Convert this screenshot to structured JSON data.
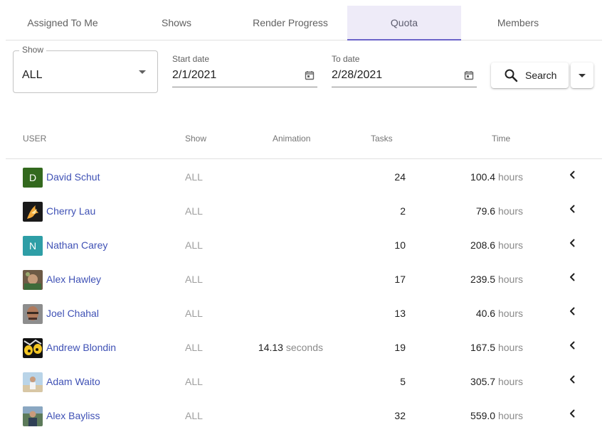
{
  "tabs": [
    {
      "label": "Assigned To Me",
      "active": false
    },
    {
      "label": "Shows",
      "active": false
    },
    {
      "label": "Render Progress",
      "active": false
    },
    {
      "label": "Quota",
      "active": true
    },
    {
      "label": "Members",
      "active": false
    }
  ],
  "filters": {
    "show": {
      "label": "Show",
      "value": "ALL"
    },
    "start_date": {
      "label": "Start date",
      "value": "2/1/2021"
    },
    "to_date": {
      "label": "To date",
      "value": "2/28/2021"
    },
    "search_label": "Search"
  },
  "table": {
    "headers": {
      "user": "USER",
      "show": "Show",
      "animation": "Animation",
      "tasks": "Tasks",
      "time": "Time"
    },
    "rows": [
      {
        "name": "David Schut",
        "avatar": {
          "type": "letter",
          "letter": "D",
          "color": "#33691e"
        },
        "show": "ALL",
        "animation_value": "",
        "animation_unit": "",
        "tasks": "24",
        "time_value": "100.4",
        "time_unit": "hours"
      },
      {
        "name": "Cherry Lau",
        "avatar": {
          "type": "image",
          "icon": "flame-figure-avatar"
        },
        "show": "ALL",
        "animation_value": "",
        "animation_unit": "",
        "tasks": "2",
        "time_value": "79.6",
        "time_unit": "hours"
      },
      {
        "name": "Nathan Carey",
        "avatar": {
          "type": "letter",
          "letter": "N",
          "color": "#2e9ea6"
        },
        "show": "ALL",
        "animation_value": "",
        "animation_unit": "",
        "tasks": "10",
        "time_value": "208.6",
        "time_unit": "hours"
      },
      {
        "name": "Alex Hawley",
        "avatar": {
          "type": "image",
          "icon": "photo-avatar"
        },
        "show": "ALL",
        "animation_value": "",
        "animation_unit": "",
        "tasks": "17",
        "time_value": "239.5",
        "time_unit": "hours"
      },
      {
        "name": "Joel Chahal",
        "avatar": {
          "type": "image",
          "icon": "portrait-avatar"
        },
        "show": "ALL",
        "animation_value": "",
        "animation_unit": "",
        "tasks": "13",
        "time_value": "40.6",
        "time_unit": "hours"
      },
      {
        "name": "Andrew Blondin",
        "avatar": {
          "type": "image",
          "icon": "cartoon-eyes-avatar"
        },
        "show": "ALL",
        "animation_value": "14.13",
        "animation_unit": "seconds",
        "tasks": "19",
        "time_value": "167.5",
        "time_unit": "hours"
      },
      {
        "name": "Adam Waito",
        "avatar": {
          "type": "image",
          "icon": "beach-photo-avatar"
        },
        "show": "ALL",
        "animation_value": "",
        "animation_unit": "",
        "tasks": "5",
        "time_value": "305.7",
        "time_unit": "hours"
      },
      {
        "name": "Alex Bayliss",
        "avatar": {
          "type": "image",
          "icon": "outdoor-photo-avatar"
        },
        "show": "ALL",
        "animation_value": "",
        "animation_unit": "",
        "tasks": "32",
        "time_value": "559.0",
        "time_unit": "hours"
      }
    ]
  }
}
